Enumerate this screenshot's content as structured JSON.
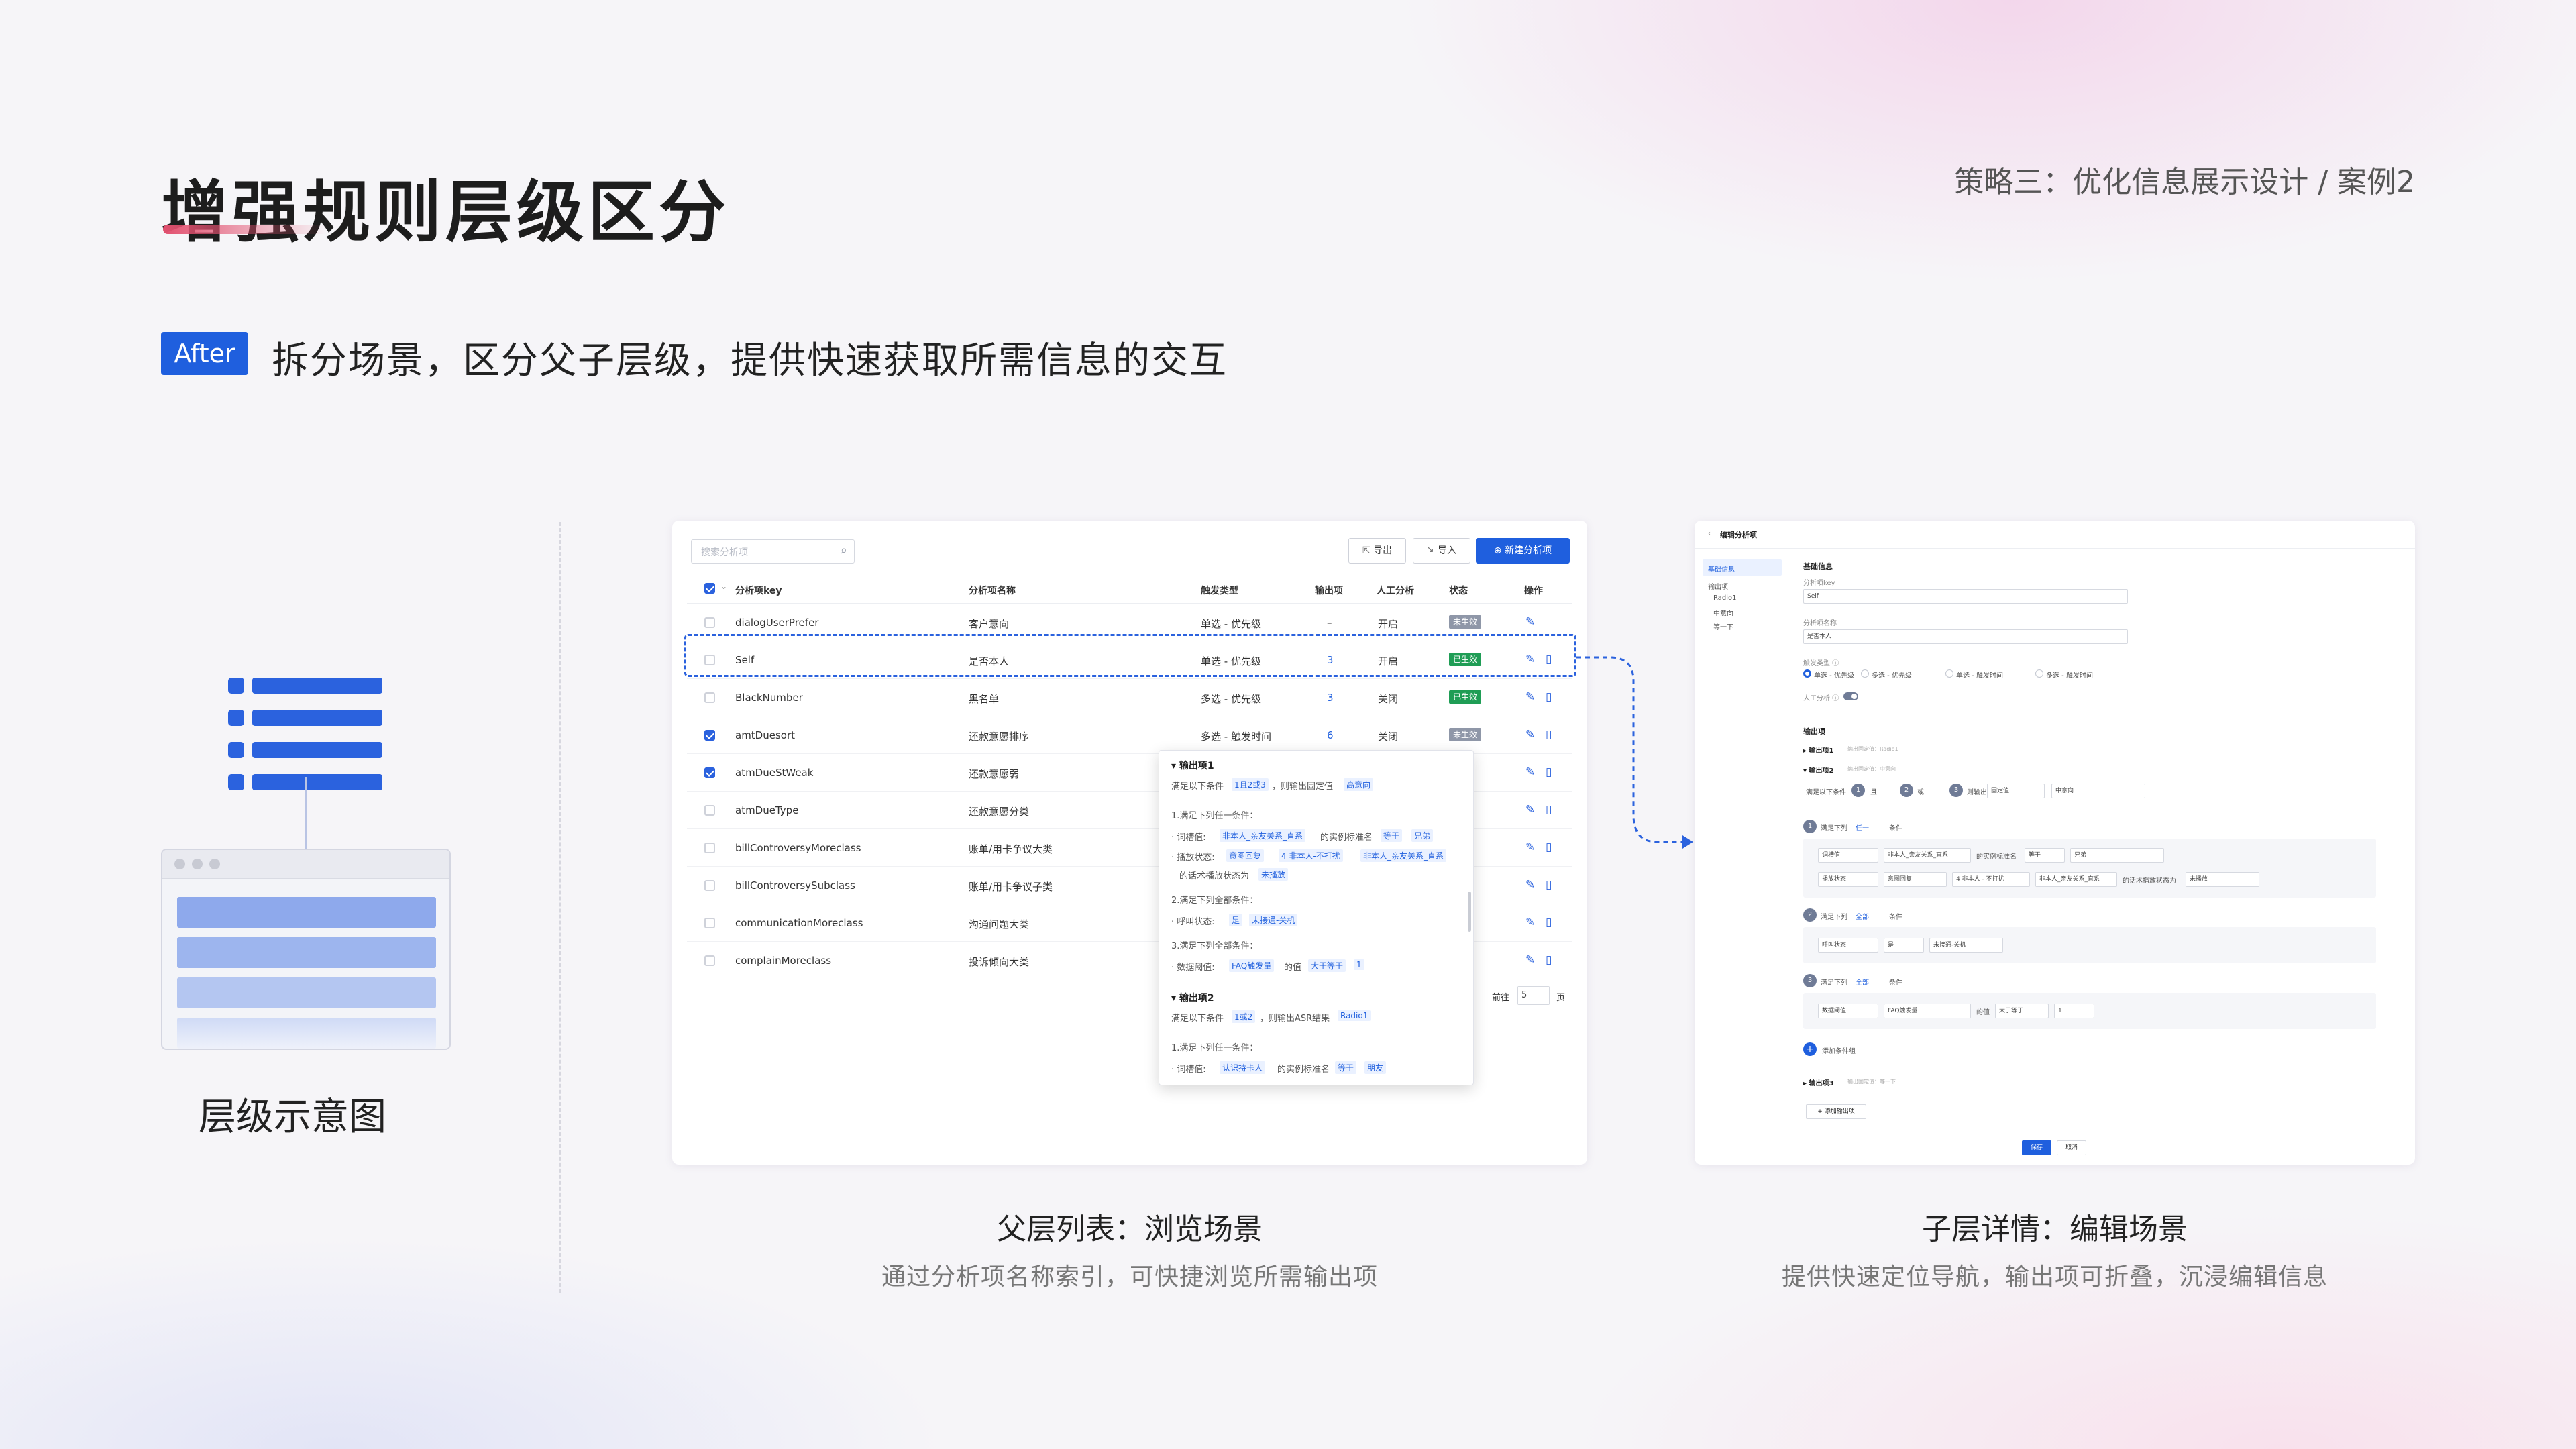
{
  "header": {
    "title": "增强规则层级区分",
    "breadcrumb": "策略三：优化信息展示设计 / 案例2"
  },
  "after": {
    "badge": "After",
    "subtitle": "拆分场景，区分父子层级，提供快速获取所需信息的交互"
  },
  "illustration": {
    "label": "层级示意图"
  },
  "list_card": {
    "search_placeholder": "搜索分析项",
    "export_label": "导出",
    "import_label": "导入",
    "new_label": "新建分析项",
    "columns": [
      "分析项key",
      "分析项名称",
      "触发类型",
      "输出项",
      "人工分析",
      "状态",
      "操作"
    ],
    "rows": [
      {
        "key": "dialogUserPrefer",
        "name": "客户意向",
        "trigger": "单选 - 优先级",
        "output": "–",
        "manual": "开启",
        "status": "未生效",
        "checked": false
      },
      {
        "key": "Self",
        "name": "是否本人",
        "trigger": "单选 - 优先级",
        "output": "3",
        "manual": "开启",
        "status": "已生效",
        "checked": false
      },
      {
        "key": "BlackNumber",
        "name": "黑名单",
        "trigger": "多选 - 优先级",
        "output": "3",
        "manual": "关闭",
        "status": "已生效",
        "checked": false
      },
      {
        "key": "amtDuesort",
        "name": "还款意愿排序",
        "trigger": "多选 - 触发时间",
        "output": "6",
        "manual": "关闭",
        "status": "未生效",
        "checked": true
      },
      {
        "key": "atmDueStWeak",
        "name": "还款意愿弱",
        "trigger": "",
        "output": "",
        "manual": "",
        "status": "",
        "checked": true
      },
      {
        "key": "atmDueType",
        "name": "还款意愿分类",
        "trigger": "",
        "output": "",
        "manual": "",
        "status": "",
        "checked": false
      },
      {
        "key": "billControversyMoreclass",
        "name": "账单/用卡争议大类",
        "trigger": "",
        "output": "",
        "manual": "",
        "status": "",
        "checked": false
      },
      {
        "key": "billControversySubclass",
        "name": "账单/用卡争议子类",
        "trigger": "",
        "output": "",
        "manual": "",
        "status": "",
        "checked": false
      },
      {
        "key": "communicationMoreclass",
        "name": "沟通问题大类",
        "trigger": "",
        "output": "",
        "manual": "",
        "status": "",
        "checked": false
      },
      {
        "key": "complainMoreclass",
        "name": "投诉倾向大类",
        "trigger": "",
        "output": "",
        "manual": "",
        "status": "",
        "checked": false
      }
    ],
    "pager": {
      "goto": "前往",
      "page": "5",
      "unit": "页"
    },
    "popover": {
      "out1_title": "输出项1",
      "cond1_prefix": "满足以下条件",
      "cond1_chip": "1且2或3",
      "cond1_mid": "，则输出固定值",
      "cond1_val": "高意向",
      "g1_title": "1.满足下列任一条件：",
      "g1_l1_label": "词槽值:",
      "g1_l1_a": "非本人_亲友关系_直系",
      "g1_l1_b": "的实例标准名",
      "g1_l1_op": "等于",
      "g1_l1_v": "兄弟",
      "g1_l2_label": "播放状态:",
      "g1_l2_a": "意图回复",
      "g1_l2_b": "4 非本人-不打扰",
      "g1_l2_c": "非本人_亲友关系_直系",
      "g1_l3_a": "的话术播放状态为",
      "g1_l3_v": "未播放",
      "g2_title": "2.满足下列全部条件：",
      "g2_l1_label": "呼叫状态:",
      "g2_l1_a": "是",
      "g2_l1_v": "未接通-关机",
      "g3_title": "3.满足下列全部条件：",
      "g3_l1_label": "数据阈值:",
      "g3_l1_a": "FAQ触发量",
      "g3_l1_b": "的值",
      "g3_l1_op": "大于等于",
      "g3_l1_v": "1",
      "out2_title": "输出项2",
      "cond2_prefix": "满足以下条件",
      "cond2_chip": "1或2",
      "cond2_mid": "，则输出ASR结果",
      "cond2_val": "Radio1",
      "g4_title": "1.满足下列任一条件：",
      "g4_l1_label": "词槽值:",
      "g4_l1_a": "认识持卡人",
      "g4_l1_b": "的实例标准名",
      "g4_l1_op": "等于",
      "g4_l1_v": "朋友"
    }
  },
  "detail_card": {
    "back_title": "编辑分析项",
    "nav": [
      "基础信息",
      "输出项",
      "Radio1",
      "中意向",
      "等一下"
    ],
    "basic_title": "基础信息",
    "key_label": "分析项key",
    "key_value": "Self",
    "name_label": "分析项名称",
    "name_value": "是否本人",
    "trigger_label": "触发类型 ⓘ",
    "radios": [
      "单选 - 优先级",
      "多选 - 优先级",
      "单选 - 触发时间",
      "多选 - 触发时间"
    ],
    "manual_label": "人工分析 ⓘ",
    "output_title": "输出项",
    "out1": "输出项1",
    "out1_hint": "输出固定值：Radio1",
    "out2": "输出项2",
    "out2_hint": "输出固定值：中意向",
    "cond_prefix": "满足以下条件",
    "cond_and": "且",
    "cond_or": "或",
    "cond_then": "则输出",
    "cond_type": "固定值",
    "cond_val": "中意向",
    "g1_head": "满足下列",
    "g1_sel": "任一",
    "g1_tail": "条件",
    "g1_r1": [
      "词槽值",
      "非本人_亲友关系_直系",
      "的实例标准名",
      "等于",
      "兄弟"
    ],
    "g1_r2": [
      "播放状态",
      "意图回复",
      "4 非本人 - 不打扰",
      "非本人_亲友关系_直系",
      "的话术播放状态为",
      "未播放"
    ],
    "g2_head": "满足下列",
    "g2_sel": "全部",
    "g2_tail": "条件",
    "g2_r1": [
      "呼叫状态",
      "是",
      "未接通-关机"
    ],
    "g3_head": "满足下列",
    "g3_sel": "全部",
    "g3_tail": "条件",
    "g3_r1": [
      "数据阈值",
      "FAQ触发量",
      "的值",
      "大于等于",
      "1"
    ],
    "add_group": "添加条件组",
    "out3": "输出项3",
    "out3_hint": "输出固定值：等一下",
    "add_output": "+ 添加输出项",
    "save": "保存",
    "cancel": "取消"
  },
  "captions": {
    "left_title": "父层列表：浏览场景",
    "left_sub": "通过分析项名称索引，可快捷浏览所需输出项",
    "right_title": "子层详情：编辑场景",
    "right_sub": "提供快速定位导航，输出项可折叠，沉浸编辑信息"
  },
  "colors": {
    "accent": "#1f5fde",
    "active": "#1f9d55",
    "inactive": "#8f97a8",
    "title_underline": "#e2506f"
  }
}
